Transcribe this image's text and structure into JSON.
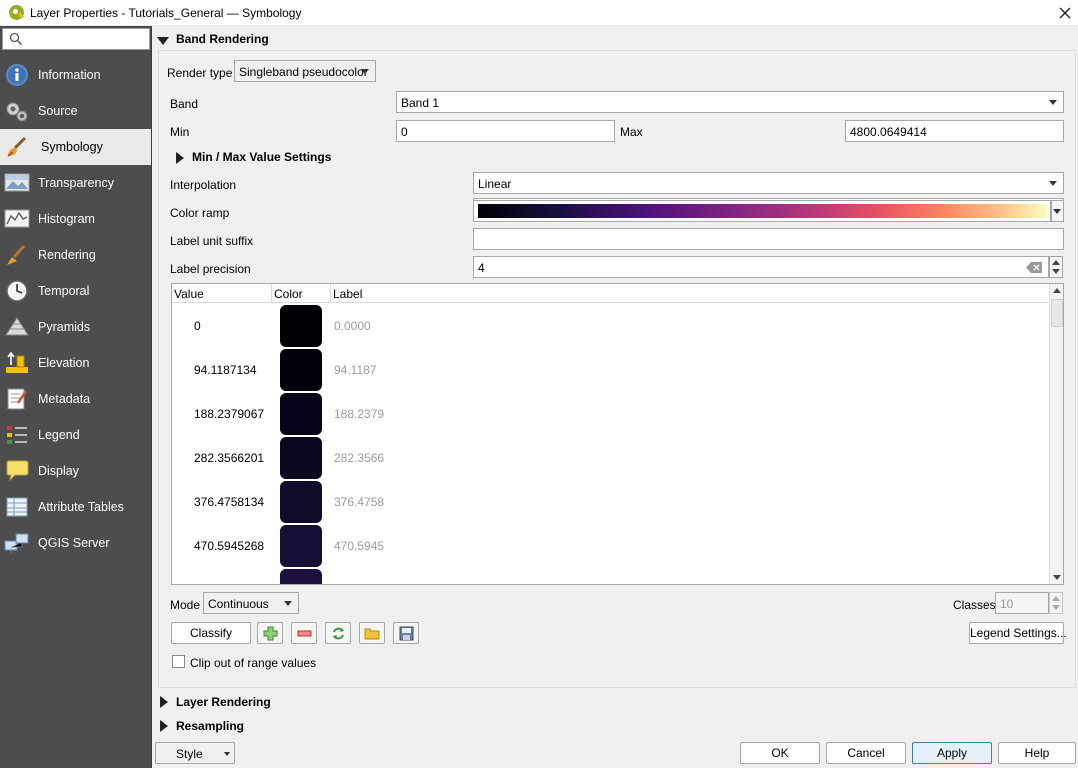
{
  "window": {
    "title": "Layer Properties - Tutorials_General — Symbology",
    "close_icon": "close-icon"
  },
  "sidebar": {
    "search_placeholder": "",
    "items": [
      {
        "label": "Information",
        "icon": "info-icon"
      },
      {
        "label": "Source",
        "icon": "source-icon"
      },
      {
        "label": "Symbology",
        "icon": "paintbrush-icon"
      },
      {
        "label": "Transparency",
        "icon": "transparency-icon"
      },
      {
        "label": "Histogram",
        "icon": "histogram-icon"
      },
      {
        "label": "Rendering",
        "icon": "rendering-brush-icon"
      },
      {
        "label": "Temporal",
        "icon": "clock-icon"
      },
      {
        "label": "Pyramids",
        "icon": "pyramids-icon"
      },
      {
        "label": "Elevation",
        "icon": "elevation-icon"
      },
      {
        "label": "Metadata",
        "icon": "metadata-icon"
      },
      {
        "label": "Legend",
        "icon": "legend-icon"
      },
      {
        "label": "Display",
        "icon": "speech-bubble-icon"
      },
      {
        "label": "Attribute Tables",
        "icon": "table-icon"
      },
      {
        "label": "QGIS Server",
        "icon": "server-icon"
      }
    ],
    "selected": "Symbology"
  },
  "band_rendering": {
    "header": "Band Rendering",
    "render_type_label": "Render type",
    "render_type_value": "Singleband pseudocolor",
    "band_label": "Band",
    "band_value": "Band 1",
    "min_label": "Min",
    "min_value": "0",
    "max_label": "Max",
    "max_value": "4800.0649414",
    "minmax_settings": "Min / Max Value Settings",
    "interpolation_label": "Interpolation",
    "interpolation_value": "Linear",
    "color_ramp_label": "Color ramp",
    "label_unit_suffix_label": "Label unit suffix",
    "label_unit_suffix_value": "",
    "label_precision_label": "Label precision",
    "label_precision_value": "4",
    "table": {
      "columns": [
        "Value",
        "Color",
        "Label"
      ],
      "rows": [
        {
          "value": "0",
          "color": "#000004",
          "label": "0.0000"
        },
        {
          "value": "94.1187134",
          "color": "#02020b",
          "label": "94.1187"
        },
        {
          "value": "188.2379067",
          "color": "#050416",
          "label": "188.2379"
        },
        {
          "value": "282.3566201",
          "color": "#0a0720",
          "label": "282.3566"
        },
        {
          "value": "376.4758134",
          "color": "#100b2b",
          "label": "376.4758"
        },
        {
          "value": "470.5945268",
          "color": "#150e35",
          "label": "470.5945"
        },
        {
          "value": "",
          "color": "#1b1040",
          "label": ""
        }
      ]
    },
    "mode_label": "Mode",
    "mode_value": "Continuous",
    "classes_label": "Classes",
    "classes_value": "10",
    "classify_button": "Classify",
    "legend_settings_button": "Legend Settings...",
    "clip_label": "Clip out of range values",
    "clip_checked": false
  },
  "layer_rendering_header": "Layer Rendering",
  "resampling_header": "Resampling",
  "footer": {
    "style_button": "Style",
    "ok": "OK",
    "cancel": "Cancel",
    "apply": "Apply",
    "help": "Help"
  }
}
